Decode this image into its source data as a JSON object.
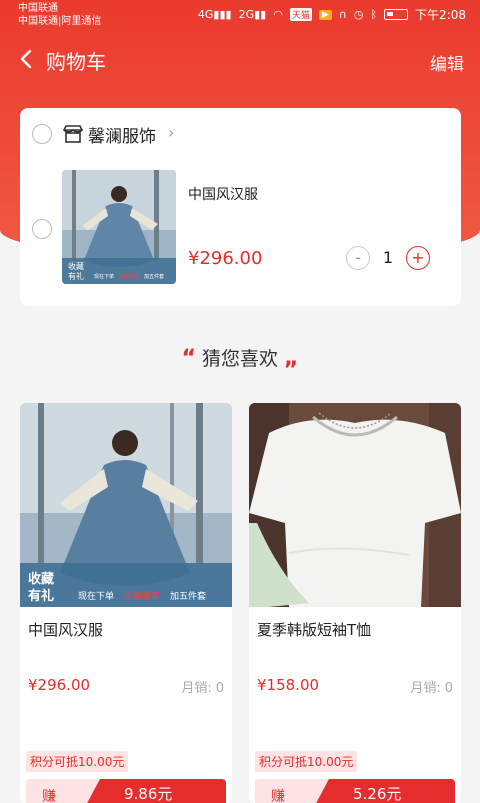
{
  "status_bar": {
    "carrier_line1": "中国联通",
    "carrier_line2": "中国联通|阿里通信",
    "time": "下午2:08",
    "app_tag": "天猫"
  },
  "nav": {
    "title": "购物车",
    "edit_label": "编辑",
    "accent_color": "#ea3a2e"
  },
  "cart": {
    "shop_name": "馨澜服饰",
    "item": {
      "title": "中国风汉服",
      "price": "¥296.00",
      "quantity": "1",
      "minus": "-",
      "plus": "+"
    }
  },
  "recommend": {
    "heading": "猜您喜欢",
    "quote_open": "“",
    "quote_close": "„",
    "items": [
      {
        "title": "中国风汉服",
        "price": "¥296.00",
        "sales_label": "月销:",
        "sales_num": "0",
        "points": "积分可抵10.00元",
        "earn_label": "赚",
        "earn_value": "9.86元"
      },
      {
        "title": "夏季韩版短袖T恤",
        "price": "¥158.00",
        "sales_label": "月销:",
        "sales_num": "0",
        "points": "积分可抵10.00元",
        "earn_label": "赚",
        "earn_value": "5.26元"
      }
    ]
  },
  "product_image_badges": {
    "line1": "收藏",
    "line2": "有礼",
    "promo_a": "现在下单",
    "promo_b": "送换装套",
    "promo_c": "加五件套"
  }
}
